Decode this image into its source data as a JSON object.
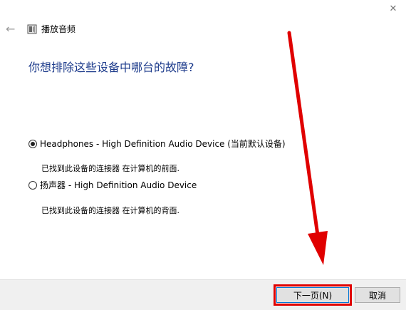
{
  "window": {
    "title": "播放音频",
    "close_symbol": "✕",
    "back_symbol": "←"
  },
  "main": {
    "heading": "你想排除这些设备中哪台的故障?",
    "options": [
      {
        "label": "Headphones - High Definition Audio Device (当前默认设备)",
        "description": "已找到此设备的连接器 在计算机的前面.",
        "selected": true
      },
      {
        "label": "扬声器 - High Definition Audio Device",
        "description": "已找到此设备的连接器 在计算机的背面.",
        "selected": false
      }
    ]
  },
  "footer": {
    "next_label": "下一页(N)",
    "cancel_label": "取消"
  },
  "colors": {
    "heading": "#1e3c8c",
    "annotation": "#e00000"
  }
}
